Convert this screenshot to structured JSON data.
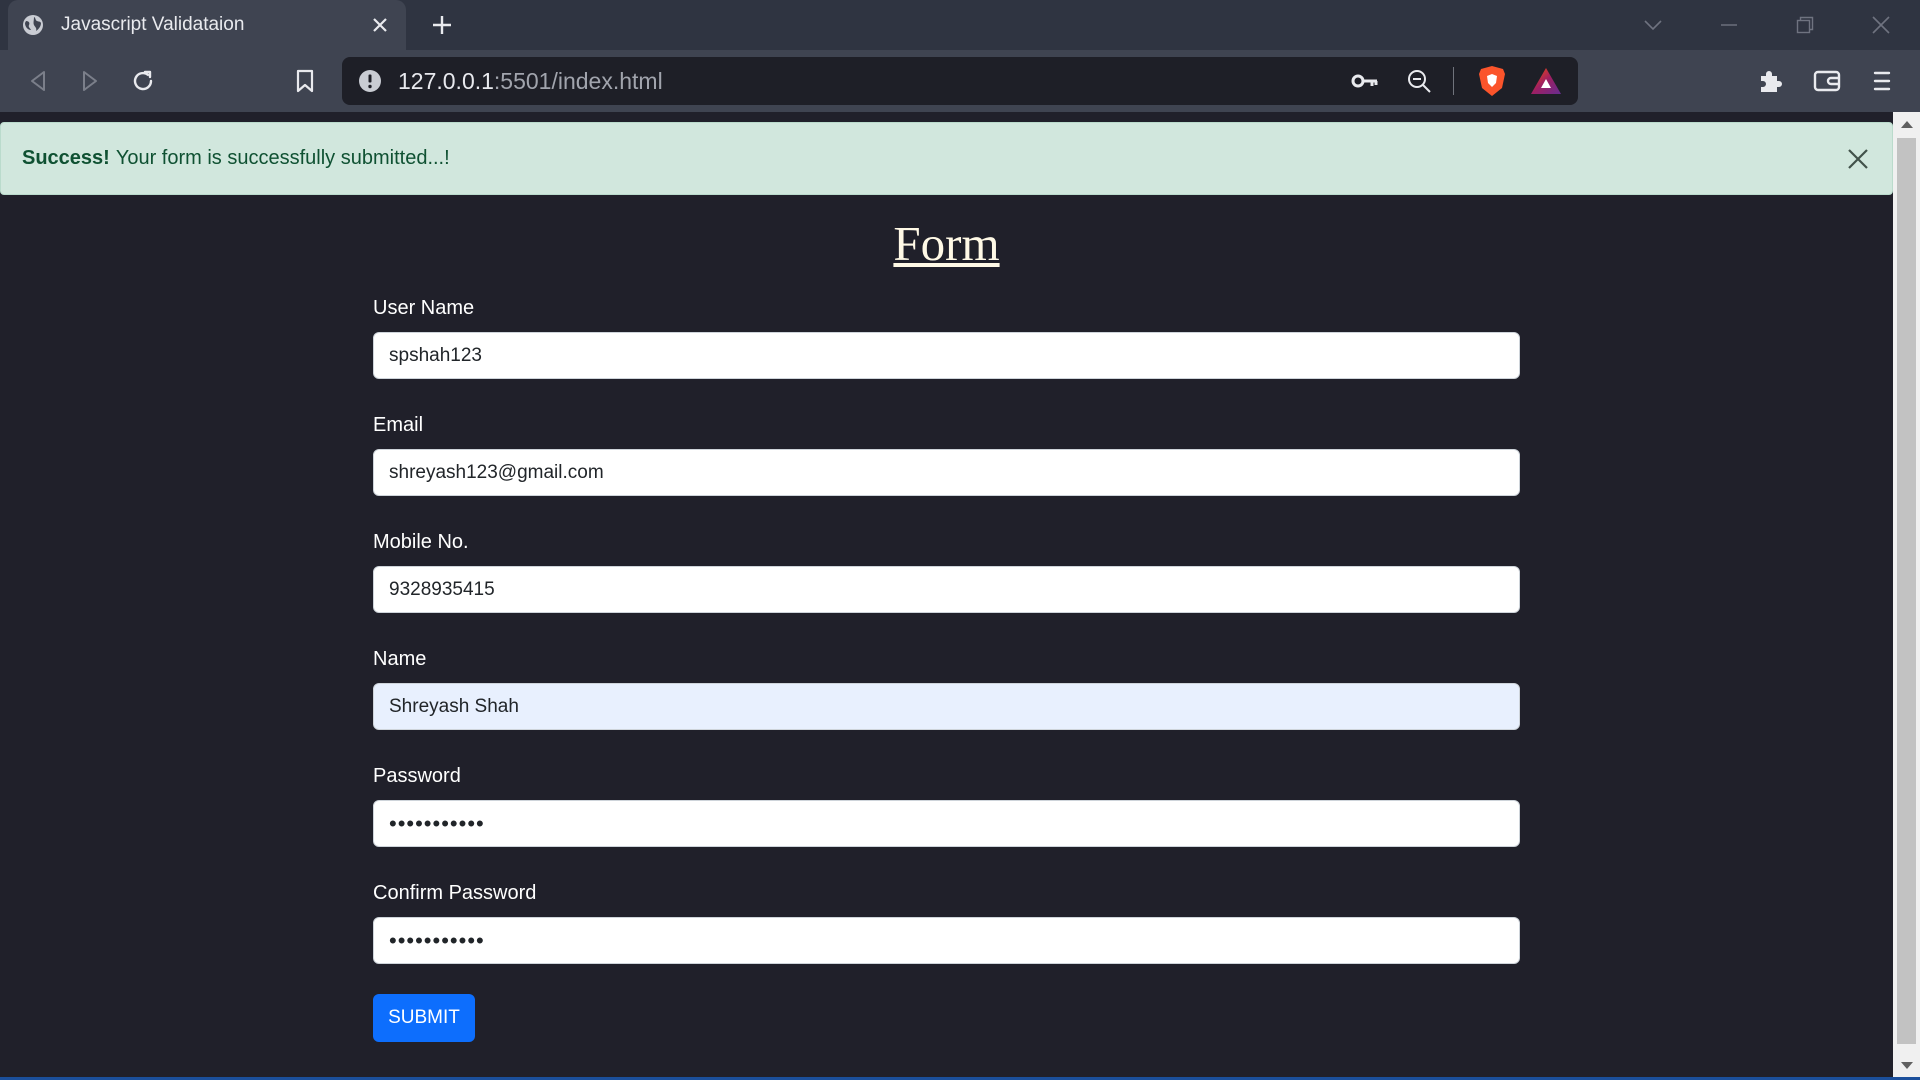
{
  "browser": {
    "tab_title": "Javascript Validataion",
    "url_host": "127.0.0.1",
    "url_path": ":5501/index.html"
  },
  "alert": {
    "strong": "Success!",
    "message": "Your form is successfully submitted...!"
  },
  "form": {
    "title": "Form",
    "fields": [
      {
        "label": "User Name",
        "value": "spshah123"
      },
      {
        "label": "Email",
        "value": "shreyash123@gmail.com"
      },
      {
        "label": "Mobile No.",
        "value": "9328935415"
      },
      {
        "label": "Name",
        "value": "Shreyash Shah"
      },
      {
        "label": "Password",
        "value": "•••••••••••"
      },
      {
        "label": "Confirm Password",
        "value": "•••••••••••"
      }
    ],
    "submit_label": "SUBMIT"
  },
  "colors": {
    "chrome_bg": "#2f3441",
    "toolbar_bg": "#3f4451",
    "page_bg": "#20202a",
    "alert_bg": "#d1e7dd",
    "alert_text": "#0f5132",
    "title_color": "#fff9e6",
    "button_bg": "#0d6efd"
  },
  "icons": [
    "globe-icon",
    "close-icon",
    "plus-icon",
    "chevron-down-icon",
    "minimize-icon",
    "restore-icon",
    "back-icon",
    "forward-icon",
    "reload-icon",
    "bookmark-icon",
    "info-icon",
    "key-icon",
    "zoom-out-icon",
    "brave-shield-icon",
    "brave-rewards-icon",
    "extensions-icon",
    "wallet-icon",
    "menu-icon"
  ]
}
